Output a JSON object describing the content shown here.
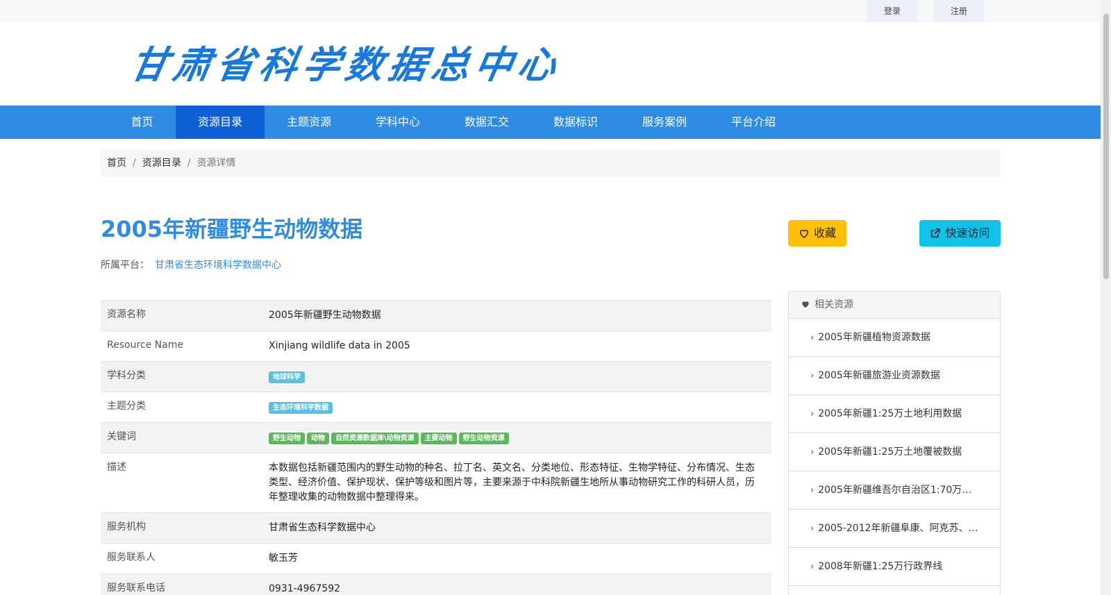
{
  "topbar": {
    "login": "登录",
    "register": "注册"
  },
  "logo": {
    "text": "甘肃省科学数据总中心"
  },
  "nav": [
    "首页",
    "资源目录",
    "主题资源",
    "学科中心",
    "数据汇交",
    "数据标识",
    "服务案例",
    "平台介绍"
  ],
  "breadcrumb": {
    "home": "首页",
    "catalog": "资源目录",
    "current": "资源详情",
    "sep": "/"
  },
  "resource": {
    "title": "2005年新疆野生动物数据",
    "platform_label": "所属平台：",
    "platform_value": "甘肃省生态环境科学数据中心"
  },
  "buttons": {
    "favorite": "收藏",
    "quick_visit": "快速访问"
  },
  "details": {
    "name_label": "资源名称",
    "name_value": "2005年新疆野生动物数据",
    "en_label": "Resource Name",
    "en_value": "Xinjiang wildlife data in 2005",
    "subject_label": "学科分类",
    "subject_tags": [
      "地球科学"
    ],
    "theme_label": "主题分类",
    "theme_tags": [
      "生态环境科学数据"
    ],
    "keyword_label": "关键词",
    "keyword_tags": [
      "野生动物",
      "动物",
      "自然资源数据库\\动物资源",
      "主要动物",
      "野生动物资源"
    ],
    "desc_label": "描述",
    "desc_value": "本数据包括新疆范围内的野生动物的种名、拉丁名、英文名、分类地位、形态特征、生物学特征、分布情况、生态类型、经济价值、保护现状、保护等级和图片等，主要来源于中科院新疆生地所从事动物研究工作的科研人员，历年整理收集的动物数据中整理得来。",
    "org_label": "服务机构",
    "org_value": "甘肃省生态科学数据中心",
    "contact_label": "服务联系人",
    "contact_value": "敏玉芳",
    "phone_label": "服务联系电话",
    "phone_value": "0931-4967592"
  },
  "related": {
    "title": "相关资源",
    "items": [
      "2005年新疆植物资源数据",
      "2005年新疆旅游业资源数据",
      "2005年新疆1:25万土地利用数据",
      "2005年新疆1:25万土地覆被数据",
      "2005年新疆维吾尔自治区1:70万…",
      "2005-2012年新疆阜康、阿克苏、…",
      "2008年新疆1:25万行政界线"
    ]
  }
}
